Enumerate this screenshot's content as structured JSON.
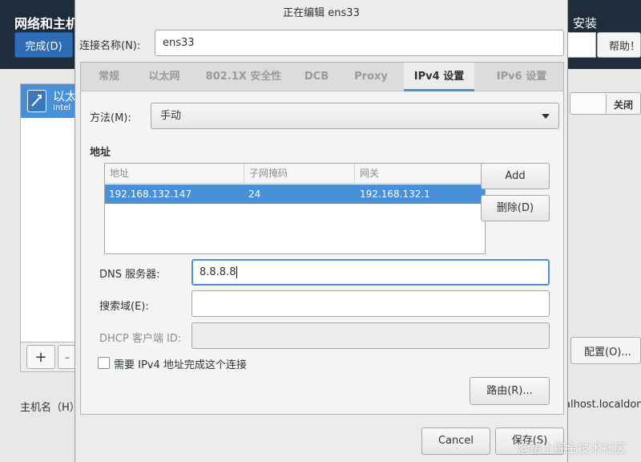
{
  "background": {
    "title": "网络和主机",
    "done_button": "完成(D)",
    "install_label": "安装",
    "help_button": "帮助！",
    "device_name": "以太",
    "device_sub": "Intel",
    "toggle_label": "关闭",
    "configure_button": "配置(O)...",
    "hostname_label": "主机名（H）",
    "hostname_value": "alhost.localdoma",
    "add_button": "+",
    "remove_button": "-"
  },
  "dialog": {
    "title": "正在编辑 ens33",
    "connection_name_label": "连接名称(N):",
    "connection_name_value": "ens33",
    "tabs": [
      {
        "label": "常规",
        "active": false
      },
      {
        "label": "以太网",
        "active": false
      },
      {
        "label": "802.1X 安全性",
        "active": false
      },
      {
        "label": "DCB",
        "active": false
      },
      {
        "label": "Proxy",
        "active": false
      },
      {
        "label": "IPv4 设置",
        "active": true
      },
      {
        "label": "IPv6 设置",
        "active": false
      }
    ],
    "ipv4": {
      "method_label": "方法(M):",
      "method_value": "手动",
      "address_section": "地址",
      "columns": [
        "地址",
        "子网掩码",
        "网关"
      ],
      "rows": [
        {
          "address": "192.168.132.147",
          "netmask": "24",
          "gateway": "192.168.132.1"
        }
      ],
      "add_button": "Add",
      "delete_button": "删除(D)",
      "dns_label": "DNS 服务器:",
      "dns_value": "8.8.8.8",
      "search_label": "搜索域(E):",
      "search_value": "",
      "dhcp_label": "DHCP 客户端 ID:",
      "dhcp_value": "",
      "require_ipv4_label": "需要 IPv4 地址完成这个连接",
      "require_ipv4_checked": false,
      "routes_button": "路由(R)..."
    },
    "cancel_button": "Cancel",
    "save_button": "保存(S)"
  },
  "watermark": "@稀土掘金技术社区",
  "colors": {
    "header_bg": "#1f2c3b",
    "accent": "#4a90d9",
    "done_button": "#2e6db6"
  }
}
